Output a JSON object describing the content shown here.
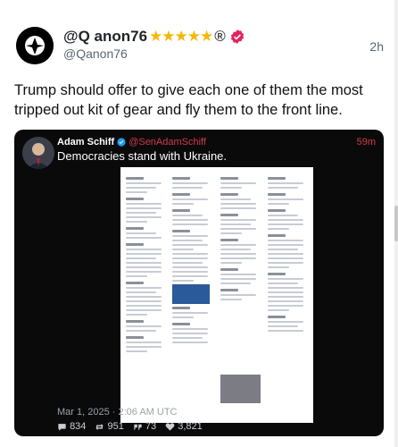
{
  "post": {
    "display_name": "@Q anon76",
    "stars": "★★★★★",
    "registered": "®",
    "handle": "@Qanon76",
    "timestamp": "2h",
    "text": "Trump should offer to give each one of them the most tripped out kit of gear and fly them to the front line."
  },
  "embed": {
    "name": "Adam Schiff",
    "handle": "@SenAdamSchiff",
    "time": "59m",
    "text": "Democracies stand with Ukraine.",
    "date": "Mar 1, 2025 · 2:06 AM UTC",
    "stats": {
      "replies": "834",
      "reposts": "951",
      "quotes": "73",
      "likes": "3,821"
    }
  },
  "icons": {
    "verified": "verified-badge-icon",
    "reply": "reply-icon",
    "repost": "repost-icon",
    "quote": "quote-icon",
    "like": "heart-icon"
  },
  "colors": {
    "verified_badge": "#e0245e",
    "embed_handle": "#d23a4b",
    "stars": "#f5b800"
  }
}
